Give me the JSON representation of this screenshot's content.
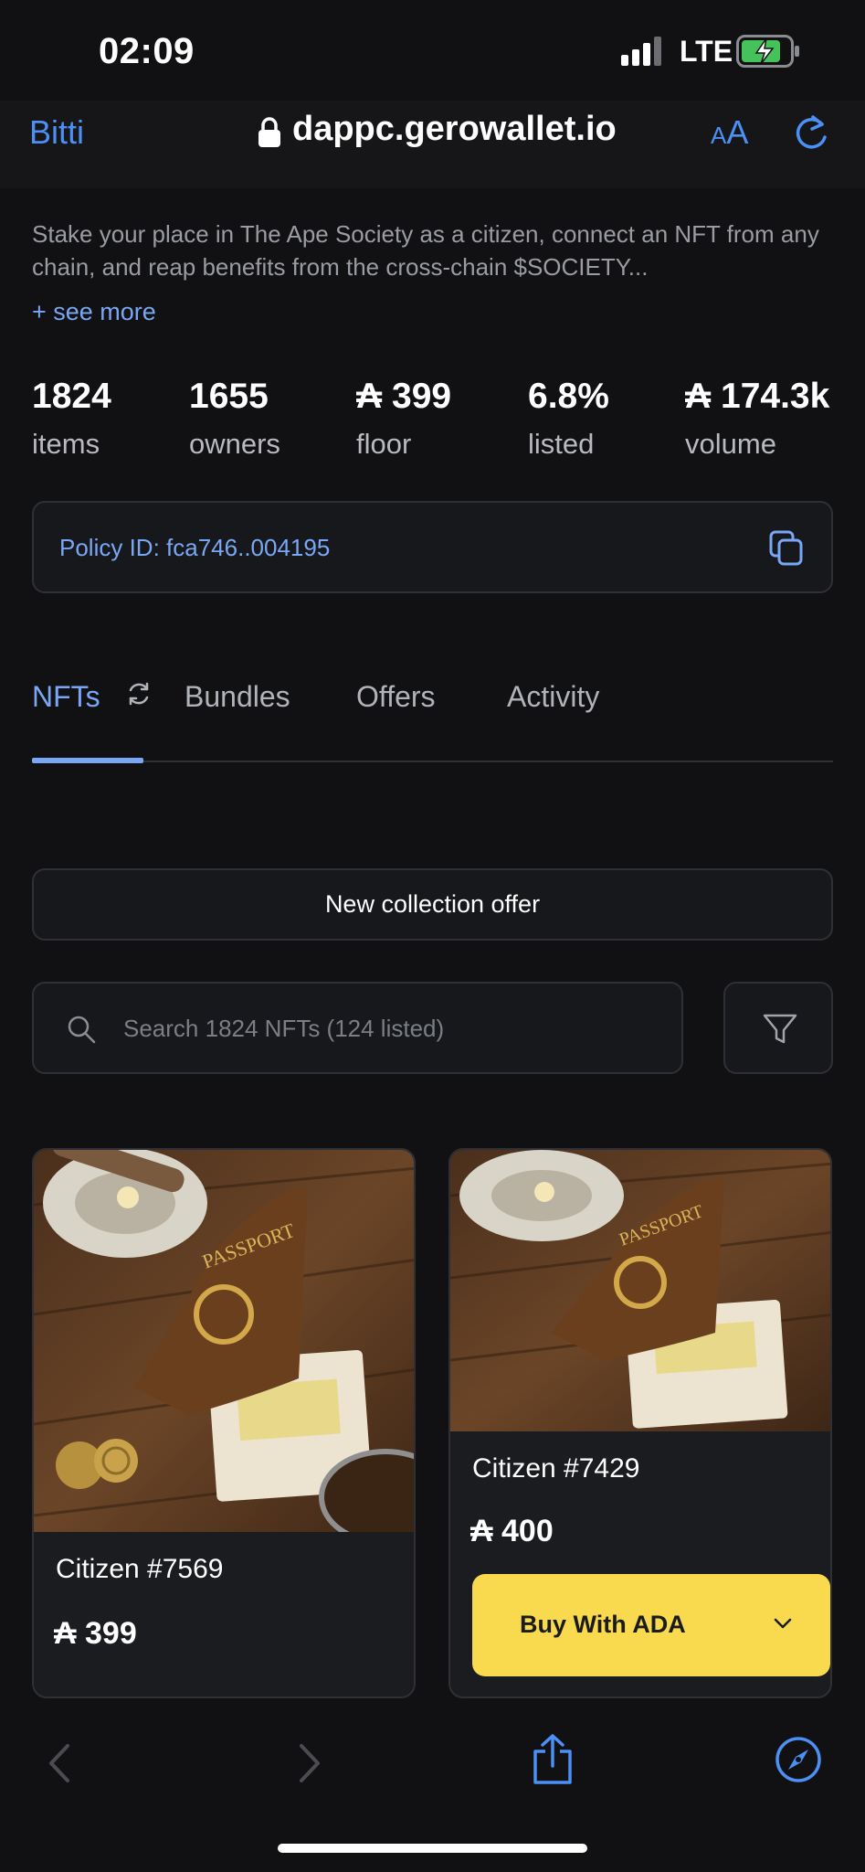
{
  "status_bar": {
    "time": "02:09",
    "network": "LTE"
  },
  "browser": {
    "back_label": "Bitti",
    "host": "dappc.gerowallet.io",
    "text_size_small": "A",
    "text_size_big": "A"
  },
  "collection": {
    "description": "Stake your place in The Ape Society as a citizen, connect an NFT from any chain, and reap benefits from the cross-chain $SOCIETY...",
    "see_more": "+ see more",
    "stats": [
      {
        "value": "1824",
        "label": "items"
      },
      {
        "value": "1655",
        "label": "owners"
      },
      {
        "value": "₳ 399",
        "label": "floor"
      },
      {
        "value": "6.8%",
        "label": "listed"
      },
      {
        "value": "₳ 174.3k",
        "label": "volume"
      }
    ],
    "policy_id": "Policy ID: fca746..004195"
  },
  "tabs": [
    {
      "label": "NFTs"
    },
    {
      "label": "Bundles"
    },
    {
      "label": "Offers"
    },
    {
      "label": "Activity"
    }
  ],
  "actions": {
    "new_offer": "New collection offer",
    "search_placeholder": "Search 1824 NFTs (124 listed)"
  },
  "nfts": [
    {
      "name": "Citizen #7569",
      "price": "₳ 399"
    },
    {
      "name": "Citizen #7429",
      "price": "₳ 400",
      "buy_label": "Buy With ADA"
    }
  ],
  "colors": {
    "accent": "#7aa7f5",
    "buy_button": "#f9da4f",
    "background": "#111113"
  },
  "icons": [
    "signal-icon",
    "battery-icon",
    "lock-icon",
    "reload-icon",
    "copy-icon",
    "refresh-icon",
    "search-icon",
    "filter-icon",
    "chevron-down-icon",
    "back-icon",
    "forward-icon",
    "share-icon",
    "compass-icon"
  ]
}
